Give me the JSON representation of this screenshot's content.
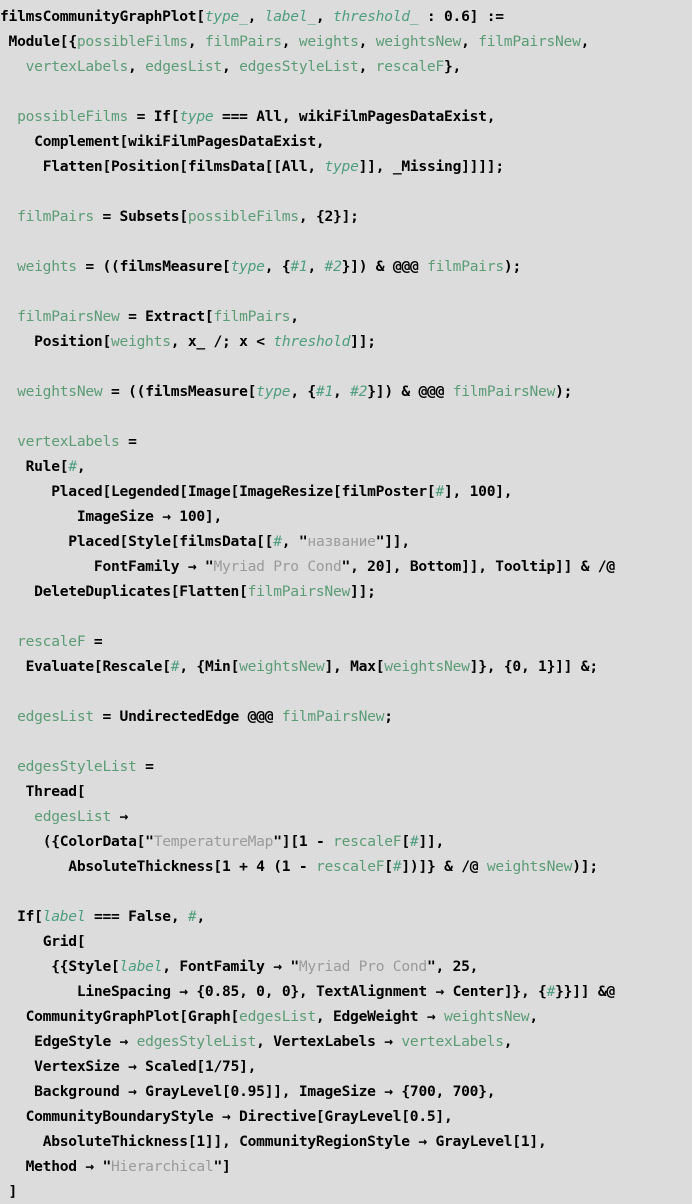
{
  "cell": {
    "language": "Wolfram Language",
    "kind": "input-cell",
    "background_color": "#dcdcdc",
    "colors": {
      "symbol": "#000000",
      "local_variable": "#5b9c77",
      "pattern_variable": "#4d9e7e",
      "string": "#9a9a9a"
    }
  },
  "code": {
    "lines": [
      "filmsCommunityGraphPlot[type_, label_, threshold_ : 0.6] :=",
      " Module[{possibleFilms, filmPairs, weights, weightsNew, filmPairsNew,",
      "   vertexLabels, edgesList, edgesStyleList, rescaleF},",
      "",
      "  possibleFilms = If[type === All, wikiFilmPagesDataExist,",
      "    Complement[wikiFilmPagesDataExist,",
      "     Flatten[Position[filmsData[[All, type]], _Missing]]]];",
      "",
      "  filmPairs = Subsets[possibleFilms, {2}];",
      "",
      "  weights = ((filmsMeasure[type, {#1, #2}]) & @@@ filmPairs);",
      "",
      "  filmPairsNew = Extract[filmPairs,",
      "    Position[weights, x_ /; x < threshold]];",
      "",
      "  weightsNew = ((filmsMeasure[type, {#1, #2}]) & @@@ filmPairsNew);",
      "",
      "  vertexLabels =",
      "   Rule[#,",
      "      Placed[Legended[Image[ImageResize[filmPoster[#], 100],",
      "         ImageSize -> 100],",
      "        Placed[Style[filmsData[[#, \"название\"]],",
      "           FontFamily -> \"Myriad Pro Cond\", 20], Bottom]], Tooltip]] & /@",
      "    DeleteDuplicates[Flatten[filmPairsNew]];",
      "",
      "  rescaleF =",
      "   Evaluate[Rescale[#, {Min[weightsNew], Max[weightsNew]}, {0, 1}]] &;",
      "",
      "  edgesList = UndirectedEdge @@@ filmPairsNew;",
      "",
      "  edgesStyleList =",
      "   Thread[",
      "    edgesList ->",
      "     ({ColorData[\"TemperatureMap\"][1 - rescaleF[#]],",
      "        AbsoluteThickness[1 + 4 (1 - rescaleF[#])]} & /@ weightsNew)];",
      "",
      "  If[label === False, #,",
      "     Grid[",
      "      {{Style[label, FontFamily -> \"Myriad Pro Cond\", 25,",
      "         LineSpacing -> {0.85, 0, 0}, TextAlignment -> Center]}, {#}}]] &@",
      "   CommunityGraphPlot[Graph[edgesList, EdgeWeight -> weightsNew,",
      "    EdgeStyle -> edgesStyleList, VertexLabels -> vertexLabels,",
      "    VertexSize -> Scaled[1/75],",
      "    Background -> GrayLevel[0.95]], ImageSize -> {700, 700},",
      "   CommunityBoundaryStyle -> Directive[GrayLevel[0.5],",
      "     AbsoluteThickness[1]], CommunityRegionStyle -> GrayLevel[1],",
      "   Method -> \"Hierarchical\"]",
      " ]"
    ],
    "function_name": "filmsCommunityGraphPlot",
    "parameters": [
      "type_",
      "label_",
      "threshold_ : 0.6"
    ],
    "default_threshold": "0.6",
    "local_variables": [
      "possibleFilms",
      "filmPairs",
      "weights",
      "weightsNew",
      "filmPairsNew",
      "vertexLabels",
      "edgesList",
      "edgesStyleList",
      "rescaleF"
    ],
    "strings": [
      "название",
      "Myriad Pro Cond",
      "TemperatureMap",
      "Hierarchical"
    ],
    "numbers": [
      "0.6",
      "2",
      "100",
      "20",
      "25",
      "0.85",
      "0",
      "1",
      "4",
      "75",
      "0.95",
      "700",
      "0.5"
    ]
  }
}
